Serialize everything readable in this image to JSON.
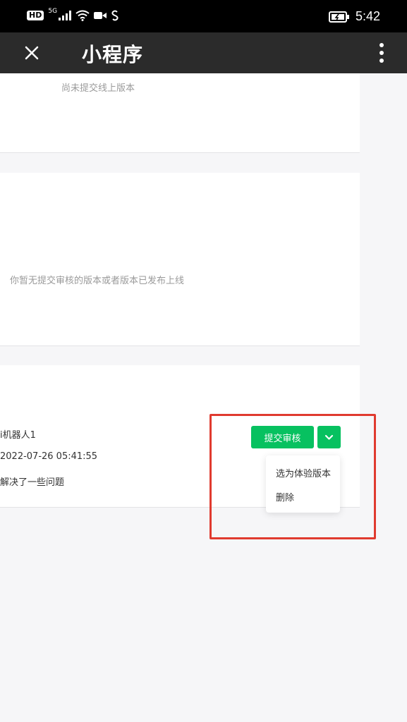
{
  "status_bar": {
    "hd_label": "HD",
    "signal_label": "5G",
    "time": "5:42"
  },
  "nav": {
    "title": "小程序"
  },
  "online_version": {
    "empty_text": "尚未提交线上版本"
  },
  "review_version": {
    "empty_text": "你暂无提交审核的版本或者版本已发布上线"
  },
  "dev_version": {
    "submitter": "i机器人1",
    "submit_time": "2022-07-26 05:41:55",
    "description": "解决了一些问题",
    "submit_review_label": "提交审核",
    "menu_items": [
      "选为体验版本",
      "删除"
    ]
  },
  "colors": {
    "accent_green": "#07c160",
    "nav_bg": "#2b2b2b",
    "highlight_red": "#e03a2f"
  },
  "icons": [
    "close-icon",
    "more-vertical-icon",
    "chevron-down-icon",
    "wifi-icon",
    "battery-icon",
    "camera-icon"
  ]
}
